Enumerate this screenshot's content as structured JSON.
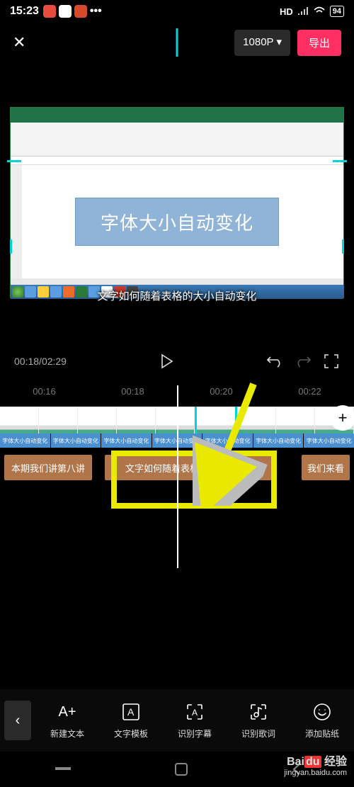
{
  "status": {
    "time": "15:23",
    "hd": "HD",
    "battery": "94"
  },
  "top": {
    "resolution": "1080P ▾",
    "export": "导出"
  },
  "preview": {
    "excel_box_text": "字体大小自动变化",
    "subtitle": "文字如何随着表格的大小自动变化"
  },
  "playback": {
    "current": "00:18",
    "total": "02:29"
  },
  "timeline": {
    "ticks": [
      "00:16",
      "00:18",
      "00:20",
      "00:22"
    ],
    "blue_segments": [
      "字体大小自动变化",
      "字体大小自动变化",
      "字体大小自动变化",
      "字体大小自动变化",
      "字体大小自动变化",
      "字体大小自动变化",
      "字体大小自动变化"
    ],
    "text_clips": {
      "c1": "本期我们讲第八讲",
      "c2": "文字如何随着表格的大小自动变",
      "c3": "我们来看"
    },
    "add": "+"
  },
  "tools": {
    "new_text": "新建文本",
    "text_template": "文字模板",
    "recognize_subtitle": "识别字幕",
    "recognize_lyrics": "识别歌词",
    "add_sticker": "添加贴纸"
  },
  "watermark": {
    "brand_a": "Bai",
    "brand_b": "du",
    "brand_c": "经验",
    "url": "jingyan.baidu.com"
  }
}
